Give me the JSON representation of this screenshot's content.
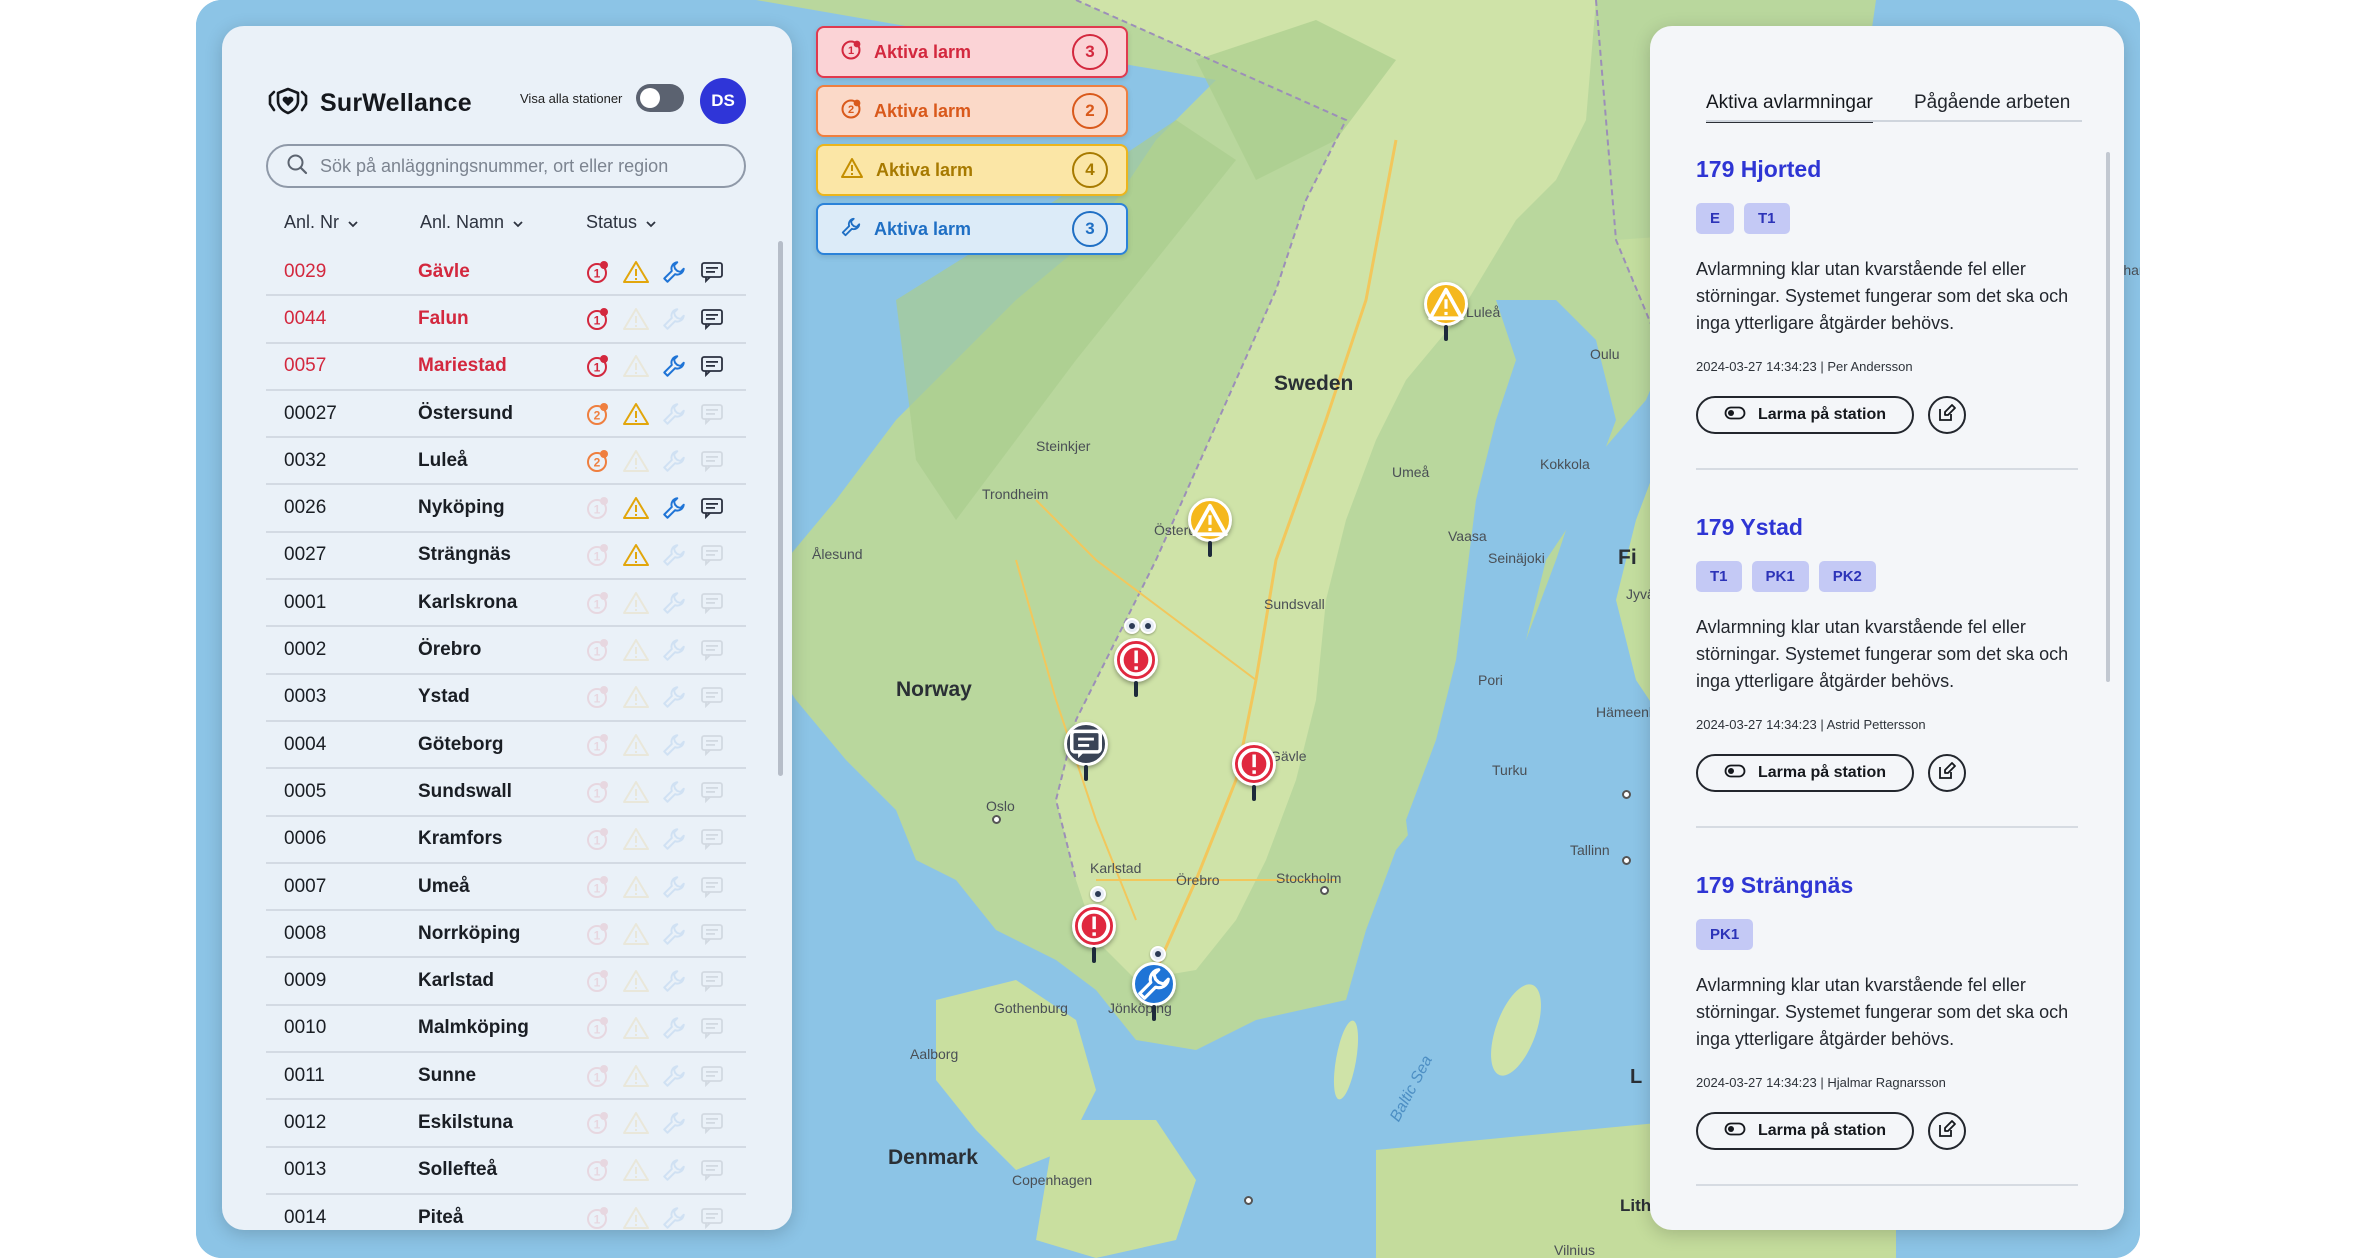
{
  "brand": {
    "name": "SurWellance"
  },
  "toggle": {
    "label": "Visa alla stationer"
  },
  "user": {
    "initials": "DS"
  },
  "search": {
    "placeholder": "Sök på anläggningsnummer, ort eller region"
  },
  "columns": {
    "nr": "Anl. Nr",
    "name": "Anl. Namn",
    "status": "Status"
  },
  "stations": [
    {
      "nr": "0029",
      "name": "Gävle",
      "alarm": true,
      "status": [
        "alarm1",
        "warning",
        "wrench",
        "message"
      ]
    },
    {
      "nr": "0044",
      "name": "Falun",
      "alarm": true,
      "status": [
        "alarm1",
        "message"
      ]
    },
    {
      "nr": "0057",
      "name": "Mariestad",
      "alarm": true,
      "status": [
        "alarm1",
        "wrench",
        "message"
      ]
    },
    {
      "nr": "00027",
      "name": "Östersund",
      "alarm": false,
      "status": [
        "alarm2",
        "warning"
      ]
    },
    {
      "nr": "0032",
      "name": "Luleå",
      "alarm": false,
      "status": [
        "alarm2"
      ]
    },
    {
      "nr": "0026",
      "name": "Nyköping",
      "alarm": false,
      "status": [
        "warning",
        "wrench",
        "message"
      ]
    },
    {
      "nr": "0027",
      "name": "Strängnäs",
      "alarm": false,
      "status": [
        "warning"
      ]
    },
    {
      "nr": "0001",
      "name": "Karlskrona",
      "alarm": false,
      "status": []
    },
    {
      "nr": "0002",
      "name": "Örebro",
      "alarm": false,
      "status": []
    },
    {
      "nr": "0003",
      "name": "Ystad",
      "alarm": false,
      "status": []
    },
    {
      "nr": "0004",
      "name": "Göteborg",
      "alarm": false,
      "status": []
    },
    {
      "nr": "0005",
      "name": "Sundswall",
      "alarm": false,
      "status": []
    },
    {
      "nr": "0006",
      "name": "Kramfors",
      "alarm": false,
      "status": []
    },
    {
      "nr": "0007",
      "name": "Umeå",
      "alarm": false,
      "status": []
    },
    {
      "nr": "0008",
      "name": "Norrköping",
      "alarm": false,
      "status": []
    },
    {
      "nr": "0009",
      "name": "Karlstad",
      "alarm": false,
      "status": []
    },
    {
      "nr": "0010",
      "name": "Malmköping",
      "alarm": false,
      "status": []
    },
    {
      "nr": "0011",
      "name": "Sunne",
      "alarm": false,
      "status": []
    },
    {
      "nr": "0012",
      "name": "Eskilstuna",
      "alarm": false,
      "status": []
    },
    {
      "nr": "0013",
      "name": "Sollefteå",
      "alarm": false,
      "status": []
    },
    {
      "nr": "0014",
      "name": "Piteå",
      "alarm": false,
      "status": []
    }
  ],
  "alarm_summary": [
    {
      "label": "Aktiva larm",
      "count": "3",
      "kind": "critical",
      "bg": "#fbd3d6",
      "border": "#e03a4f",
      "color": "#d3283e",
      "icon": "alarm1-icon"
    },
    {
      "label": "Aktiva larm",
      "count": "2",
      "kind": "high",
      "bg": "#fbd9c8",
      "border": "#ef7f3f",
      "color": "#d9591b",
      "icon": "alarm2-icon"
    },
    {
      "label": "Aktiva larm",
      "count": "4",
      "kind": "warning",
      "bg": "#fbe6a6",
      "border": "#ecb51c",
      "color": "#a77a00",
      "icon": "warning-icon"
    },
    {
      "label": "Aktiva larm",
      "count": "3",
      "kind": "maintenance",
      "bg": "#dcebf8",
      "border": "#2b82d9",
      "color": "#1f6fc4",
      "icon": "wrench-icon"
    }
  ],
  "right": {
    "tabs": [
      "Aktiva avlarmningar",
      "Pågående arbeten"
    ],
    "action_label": "Larma på station",
    "items": [
      {
        "title": "179 Hjorted",
        "tags": [
          "E",
          "T1"
        ],
        "desc": "Avlarmning klar utan kvarstående fel eller störningar. Systemet fungerar som det ska och inga ytterligare åtgärder behövs.",
        "date": "2024-03-27 14:34:23",
        "person": "Per Andersson"
      },
      {
        "title": "179 Ystad",
        "tags": [
          "T1",
          "PK1",
          "PK2"
        ],
        "desc": "Avlarmning klar utan kvarstående fel eller störningar. Systemet fungerar som det ska och inga ytterligare åtgärder behövs.",
        "date": "2024-03-27 14:34:23",
        "person": "Astrid Pettersson"
      },
      {
        "title": "179 Strängnäs",
        "tags": [
          "PK1"
        ],
        "desc": "Avlarmning klar utan kvarstående fel eller störningar. Systemet fungerar som det ska och inga ytterligare åtgärder behövs.",
        "date": "2024-03-27 14:34:23",
        "person": "Hjalmar Ragnarsson"
      }
    ]
  },
  "map": {
    "countries": [
      "Sweden",
      "Norway",
      "Denmark",
      "Fi"
    ],
    "sea": "Baltic Sea",
    "cities": [
      "Luleå",
      "Oulu",
      "Kokkola",
      "Umeå",
      "Vaasa",
      "Seinäjoki",
      "Steinkjer",
      "Trondheim",
      "Ålesund",
      "Österund",
      "Sundsvall",
      "Pori",
      "Hämeenlinna",
      "Turku",
      "Gävle",
      "Tallinn",
      "Oslo",
      "Karlstad",
      "Örebro",
      "Stockholm",
      "Gothenburg",
      "Jönköping",
      "Aalborg",
      "Copenhagen",
      "Lithuan",
      "Vilnius",
      "Jyvä",
      "Khar",
      "L"
    ]
  },
  "colors": {
    "accent": "#2e35d4",
    "alarm": "#d3283e",
    "warning": "#f5b81d",
    "maintenance": "#1f74d6"
  }
}
